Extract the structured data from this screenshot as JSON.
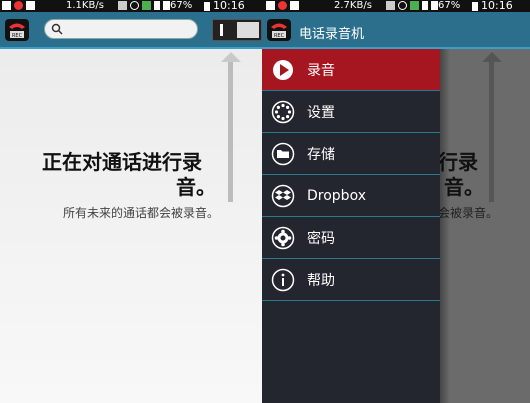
{
  "left_screen": {
    "status": {
      "speed": "1.1KB/s",
      "battery": "67%",
      "time": "10:16"
    },
    "search": {
      "placeholder": ""
    },
    "toggle": {
      "state": "on"
    },
    "message": {
      "title_line1": "正在对通话进行录",
      "title_line2": "音。",
      "subtitle": "所有未来的通话都会被录音。"
    }
  },
  "right_screen": {
    "status": {
      "speed": "2.7KB/s",
      "battery": "67%",
      "time": "10:16"
    },
    "app_title": "电话录音机",
    "background_message": {
      "title_line1": "行录",
      "title_line2": "音。",
      "subtitle": "会被录音。"
    },
    "menu": {
      "items": [
        {
          "label": "录音",
          "icon": "record-play-icon",
          "active": true
        },
        {
          "label": "设置",
          "icon": "settings-dots-icon",
          "active": false
        },
        {
          "label": "存储",
          "icon": "folder-icon",
          "active": false
        },
        {
          "label": "Dropbox",
          "icon": "dropbox-icon",
          "active": false
        },
        {
          "label": "密码",
          "icon": "asterisk-icon",
          "active": false
        },
        {
          "label": "帮助",
          "icon": "info-icon",
          "active": false
        }
      ]
    }
  },
  "colors": {
    "appbar": "#2c6f8c",
    "drawer": "#23262e",
    "active_item": "#a51620",
    "divider": "#2a7a8f"
  }
}
